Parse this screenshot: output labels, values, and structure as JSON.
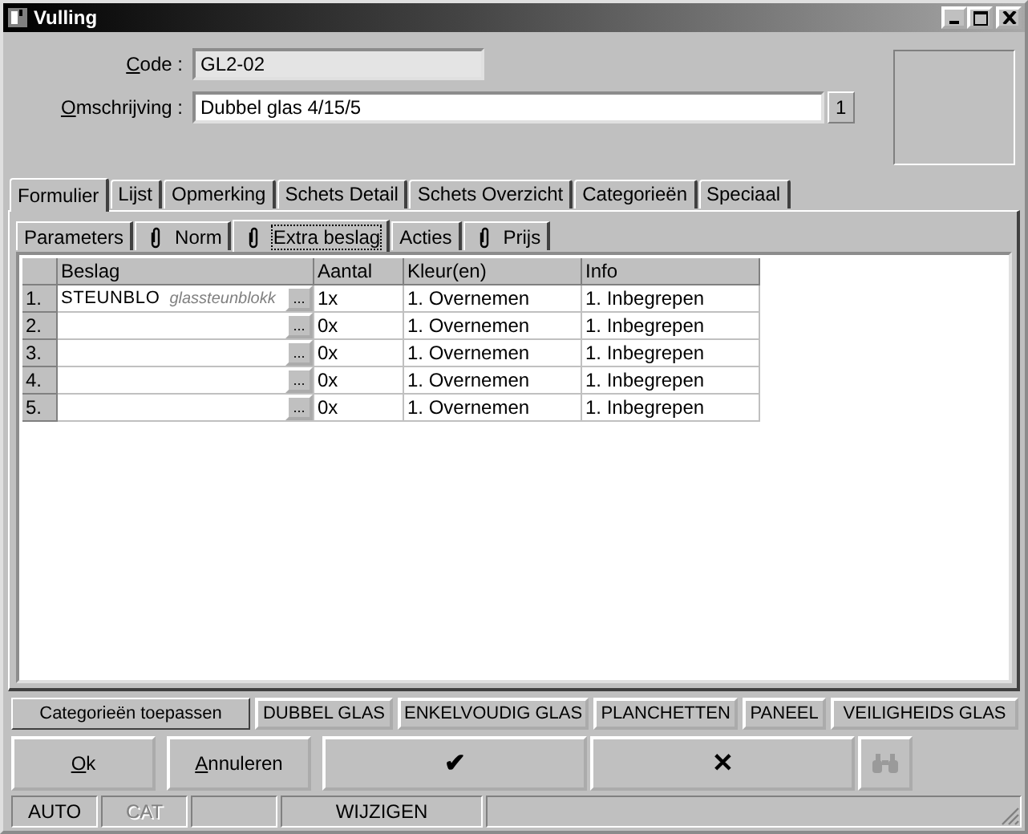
{
  "window": {
    "title": "Vulling"
  },
  "fields": [
    {
      "label": "Code :",
      "mnemonic": true,
      "value": "GL2-02",
      "disabled": true
    },
    {
      "label": "Omschrijving :",
      "mnemonic": true,
      "value": "Dubbel glas 4/15/5",
      "disabled": false,
      "counter": "1"
    }
  ],
  "tabs": [
    {
      "label": "Formulier",
      "selected": true
    },
    {
      "label": "Lijst",
      "selected": false
    },
    {
      "label": "Opmerking",
      "selected": false
    },
    {
      "label": "Schets Detail",
      "selected": false
    },
    {
      "label": "Schets Overzicht",
      "selected": false
    },
    {
      "label": "Categorieën",
      "selected": false
    },
    {
      "label": "Speciaal",
      "selected": false
    }
  ],
  "subtabs": [
    {
      "label": "Parameters",
      "attachment": false,
      "selected": false
    },
    {
      "label": "Norm",
      "attachment": true,
      "selected": false
    },
    {
      "label": "Extra beslag",
      "attachment": true,
      "selected": true
    },
    {
      "label": "Acties",
      "attachment": false,
      "selected": false
    },
    {
      "label": "Prijs",
      "attachment": true,
      "selected": false
    }
  ],
  "table": {
    "columns": [
      "Beslag",
      "Aantal",
      "Kleur(en)",
      "Info"
    ],
    "rows": [
      {
        "number": "1.",
        "beslag": "STEUNBLO",
        "description": "glassteunblokk",
        "button": "...",
        "aantal": "1x",
        "kleur": "1. Overnemen",
        "info": "1. Inbegrepen"
      },
      {
        "number": "2.",
        "button": "...",
        "aantal": "0x",
        "kleur": "1. Overnemen",
        "info": "1. Inbegrepen"
      },
      {
        "number": "3.",
        "button": "...",
        "aantal": "0x",
        "kleur": "1. Overnemen",
        "info": "1. Inbegrepen"
      },
      {
        "number": "4.",
        "button": "...",
        "aantal": "0x",
        "kleur": "1. Overnemen",
        "info": "1. Inbegrepen"
      },
      {
        "number": "5.",
        "button": "...",
        "aantal": "0x",
        "kleur": "1. Overnemen",
        "info": "1. Inbegrepen"
      }
    ]
  },
  "categories": {
    "label": "Categorieën toepassen",
    "buttons": [
      "DUBBEL GLAS",
      "ENKELVOUDIG GLAS",
      "PLANCHETTEN",
      "PANEEL",
      "VEILIGHEIDS GLAS"
    ]
  },
  "actions": [
    {
      "kind": "text",
      "label": "Ok",
      "mnemonic": true
    },
    {
      "kind": "text",
      "label": "Annuleren",
      "mnemonic": true
    },
    {
      "kind": "text",
      "label": "✔",
      "mnemonic": false
    },
    {
      "kind": "text",
      "label": "✕",
      "mnemonic": false
    },
    {
      "kind": "binoculars"
    }
  ],
  "status_bar": [
    {
      "text": "AUTO",
      "disabled": false
    },
    {
      "text": "CAT",
      "disabled": true
    },
    {
      "text": "WIJZIGEN",
      "disabled": false
    }
  ]
}
